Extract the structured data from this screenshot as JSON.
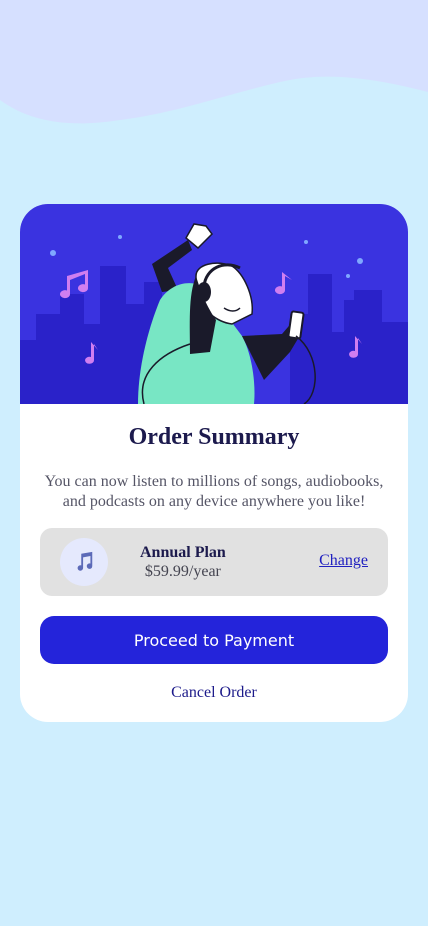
{
  "card": {
    "title": "Order Summary",
    "description": "You can now listen to millions of songs, audiobooks, and podcasts on any device anywhere you like!"
  },
  "plan": {
    "icon": "music-note-icon",
    "name": "Annual Plan",
    "price": "$59.99/year",
    "change_label": "Change"
  },
  "actions": {
    "proceed_label": "Proceed to Payment",
    "cancel_label": "Cancel Order"
  },
  "colors": {
    "page_background": "#cfeefe",
    "wave": "#d6e0ff",
    "hero": "#3a33e0",
    "accent": "#2424da",
    "plan_background": "#e1e1e1"
  }
}
